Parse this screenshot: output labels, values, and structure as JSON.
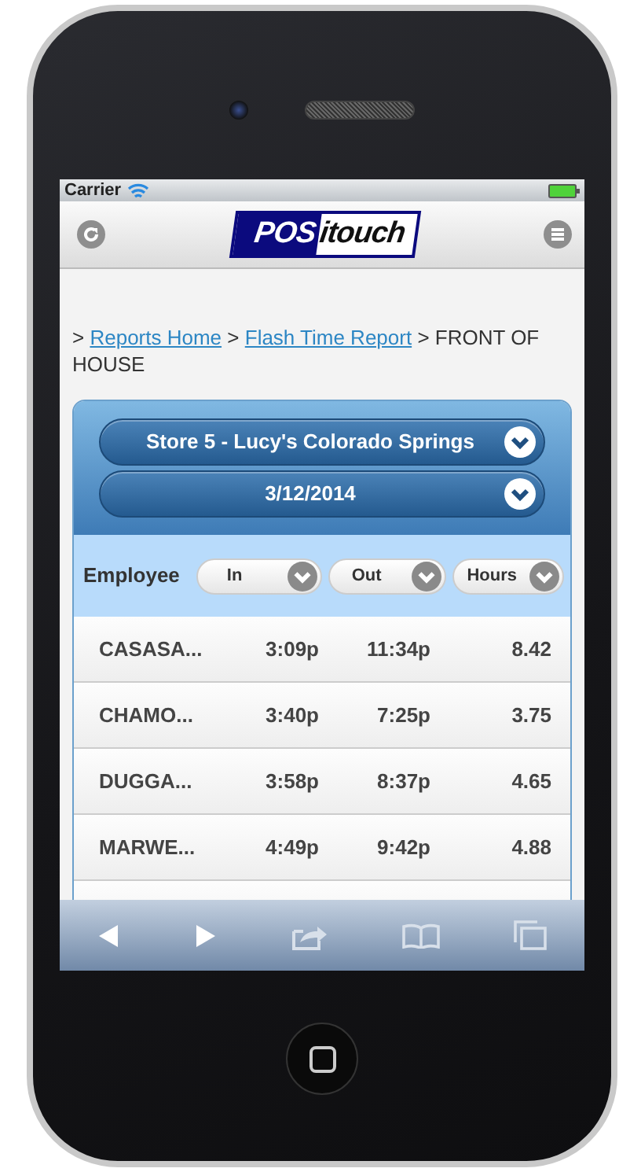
{
  "status_bar": {
    "carrier": "Carrier"
  },
  "header": {
    "logo": {
      "part_1": "POS",
      "part_2": "itouch"
    }
  },
  "breadcrumb": {
    "separator": ">",
    "items": [
      {
        "text": "Reports Home",
        "kind": "link"
      },
      {
        "text": "Flash Time Report",
        "kind": "link"
      },
      {
        "text": "FRONT OF HOUSE",
        "kind": "current"
      }
    ]
  },
  "filters": [
    {
      "value": "Store 5 - Lucy's Colorado Springs"
    },
    {
      "value": "3/12/2014"
    }
  ],
  "table": {
    "columns": [
      {
        "label": "Employee",
        "kind": "plain"
      },
      {
        "label": "In",
        "kind": "sort"
      },
      {
        "label": "Out",
        "kind": "sort"
      },
      {
        "label": "Hours",
        "kind": "sort"
      }
    ],
    "rows": [
      [
        "CASASA...",
        "3:09p",
        "11:34p",
        "8.42"
      ],
      [
        "CHAMO...",
        "3:40p",
        "7:25p",
        "3.75"
      ],
      [
        "DUGGA...",
        "3:58p",
        "8:37p",
        "4.65"
      ],
      [
        "MARWE...",
        "4:49p",
        "9:42p",
        "4.88"
      ]
    ]
  }
}
